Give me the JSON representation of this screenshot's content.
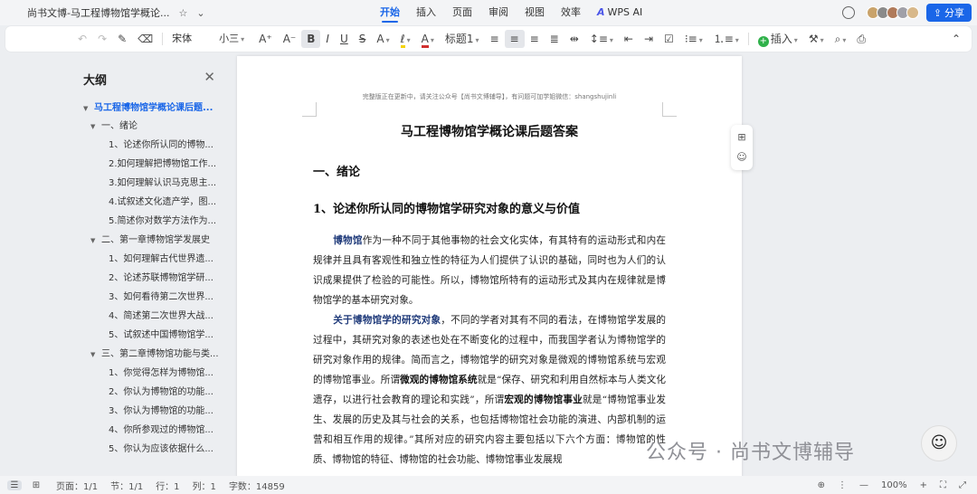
{
  "titlebar": {
    "doc_title": "尚书文博-马工程博物馆学概论...",
    "star_icon": "star-icon",
    "menu": [
      {
        "label": "开始",
        "active": true
      },
      {
        "label": "插入"
      },
      {
        "label": "页面"
      },
      {
        "label": "审阅"
      },
      {
        "label": "视图"
      },
      {
        "label": "效率"
      }
    ],
    "wps_ai": "WPS AI",
    "share_label": "分享",
    "accent_color": "#1a66e8"
  },
  "toolbar": {
    "font_name": "宋体",
    "font_size": "小三",
    "heading_style": "标题1",
    "insert_label": "插入"
  },
  "outline": {
    "title": "大纲",
    "items": [
      {
        "label": "马工程博物馆学概论课后题..."
      },
      {
        "label": "一、绪论"
      },
      {
        "label": "1、论述你所认同的博物..."
      },
      {
        "label": "2.如何理解把博物馆工作..."
      },
      {
        "label": "3.如何理解认识马克思主..."
      },
      {
        "label": "4.试叙述文化遗产学，图..."
      },
      {
        "label": "5.简述你对数学方法作为..."
      },
      {
        "label": "二、第一章博物馆学发展史"
      },
      {
        "label": "1、如何理解古代世界遗..."
      },
      {
        "label": "2、论述苏联博物馆学研..."
      },
      {
        "label": "3、如何看待第二次世界..."
      },
      {
        "label": "4、简述第二次世界大战..."
      },
      {
        "label": "5、试叙述中国博物馆学..."
      },
      {
        "label": "三、第二章博物馆功能与类..."
      },
      {
        "label": "1、你觉得怎样为博物馆..."
      },
      {
        "label": "2、你认为博物馆的功能..."
      },
      {
        "label": "3、你认为博物馆的功能..."
      },
      {
        "label": "4、你所参观过的博物馆..."
      },
      {
        "label": "5、你认为应该依据什么..."
      }
    ]
  },
  "document": {
    "header_note": "完整版正在更新中，请关注公众号【尚书文博辅导】，有问题可加学姐微信：shangshujinli",
    "title": "马工程博物馆学概论课后题答案",
    "section1": "一、绪论",
    "section2": "1、论述你所认同的博物馆学研究对象的意义与价值",
    "p1_lead": "博物馆",
    "p1_text": "作为一种不同于其他事物的社会文化实体，有其特有的运动形式和内在规律并且具有客观性和独立性的特征为人们提供了认识的基础，同时也为人们的认识成果提供了检验的可能性。所以，博物馆所特有的运动形式及其内在规律就是博物馆学的基本研究对象。",
    "p2_lead": "关于博物馆学的研究对象",
    "p2_a": "，不同的学者对其有不同的看法，在博物馆学发展的过程中，其研究对象的表述也处在不断变化的过程中，而我国学者认为博物馆学的研究对象作用的规律。简而言之，博物馆学的研究对象是微观的博物馆系统与宏观的博物馆事业。所谓",
    "p2_b1": "微观的博物馆系统",
    "p2_c": "就是“保存、研究和利用自然标本与人类文化遗存，以进行社会教育的理论和实践”，所谓",
    "p2_b2": "宏观的博物馆事业",
    "p2_d": "就是“博物馆事业发生、发展的历史及其与社会的关系，也包括博物馆社会功能的演进、内部机制的运营和相互作用的规律。”其所对应的研究内容主要包括以下六个方面：博物馆的性质、博物馆的特征、博物馆的社会功能、博物馆事业发展规"
  },
  "watermark": "公众号 · 尚书文博辅导",
  "statusbar": {
    "page": "页面：1/1",
    "section": "节：1/1",
    "row": "行：1",
    "col": "列：1",
    "word_count": "字数：14859",
    "zoom": "100%"
  }
}
